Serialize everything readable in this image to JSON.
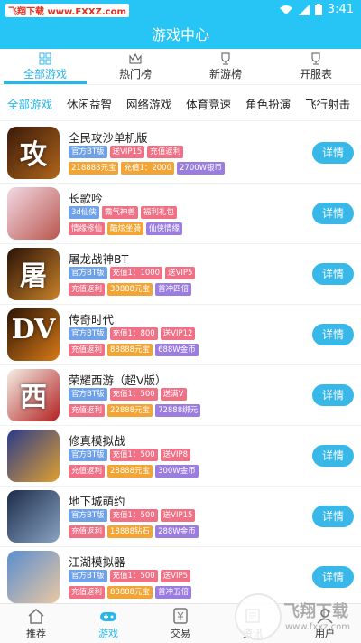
{
  "status": {
    "watermark": "飞翔下载 www.FXXZ.com",
    "time": "3:41"
  },
  "title": "游戏中心",
  "top_tabs": [
    {
      "label": "全部游戏",
      "icon": "grid-icon",
      "active": true
    },
    {
      "label": "热门榜",
      "icon": "crown-icon",
      "active": false
    },
    {
      "label": "新游榜",
      "icon": "trophy-icon",
      "active": false
    },
    {
      "label": "开服表",
      "icon": "trophy-icon",
      "active": false
    }
  ],
  "categories": [
    "全部游戏",
    "休闲益智",
    "网络游戏",
    "体育竞速",
    "角色扮演",
    "飞行射击"
  ],
  "detail_label": "详情",
  "games": [
    {
      "name": "全民攻沙单机版",
      "glyph": "攻沙",
      "icon_colors": [
        "#3a1a0a",
        "#b0651b"
      ],
      "row1": [
        [
          "官方BT版",
          "#6ea1e8"
        ],
        [
          "送VIP15",
          "#f07085"
        ],
        [
          "充值返利",
          "#f07085"
        ]
      ],
      "row2": [
        [
          "218888元宝",
          "#f2a534"
        ],
        [
          "充值1：2000",
          "#f2a534"
        ],
        [
          "2700W银币",
          "#9b7de0"
        ]
      ]
    },
    {
      "name": "长歌吟",
      "glyph": "",
      "icon_colors": [
        "#f3d9e4",
        "#b9574e"
      ],
      "row1": [
        [
          "3d仙侠",
          "#6ea1e8"
        ],
        [
          "霸气神兽",
          "#f07085"
        ],
        [
          "福利礼包",
          "#f07085"
        ]
      ],
      "row2": [
        [
          "情缘修仙",
          "#f07085"
        ],
        [
          "酷炫坐骑",
          "#f2a534"
        ],
        [
          "仙侠情缘",
          "#9b7de0"
        ]
      ]
    },
    {
      "name": "屠龙战神BT",
      "glyph": "屠",
      "icon_colors": [
        "#2a1206",
        "#c9822a"
      ],
      "row1": [
        [
          "官方BT版",
          "#6ea1e8"
        ],
        [
          "充值1：1000",
          "#f07085"
        ],
        [
          "送VIP5",
          "#f07085"
        ]
      ],
      "row2": [
        [
          "充值返利",
          "#f07085"
        ],
        [
          "38888元宝",
          "#f2a534"
        ],
        [
          "首冲四倍",
          "#9b7de0"
        ]
      ]
    },
    {
      "name": "传奇时代",
      "glyph": "DV",
      "icon_colors": [
        "#2d1505",
        "#d77a18"
      ],
      "row1": [
        [
          "官方BT版",
          "#6ea1e8"
        ],
        [
          "充值1：800",
          "#f07085"
        ],
        [
          "送VIP12",
          "#f07085"
        ]
      ],
      "row2": [
        [
          "充值返利",
          "#f07085"
        ],
        [
          "88888元宝",
          "#f2a534"
        ],
        [
          "688W金币",
          "#9b7de0"
        ]
      ]
    },
    {
      "name": "荣耀西游（超V版）",
      "glyph": "西游",
      "icon_colors": [
        "#f4efe6",
        "#b32121"
      ],
      "row1": [
        [
          "官方BT版",
          "#6ea1e8"
        ],
        [
          "充值1：500",
          "#f07085"
        ],
        [
          "送满V",
          "#f07085"
        ]
      ],
      "row2": [
        [
          "充值返利",
          "#f07085"
        ],
        [
          "22888元宝",
          "#f2a534"
        ],
        [
          "72888绑元",
          "#9b7de0"
        ]
      ]
    },
    {
      "name": "修真模拟战",
      "glyph": "",
      "icon_colors": [
        "#2a3a8a",
        "#e0a030"
      ],
      "row1": [
        [
          "官方BT版",
          "#6ea1e8"
        ],
        [
          "充值1：500",
          "#f07085"
        ],
        [
          "送VIP8",
          "#f07085"
        ]
      ],
      "row2": [
        [
          "充值返利",
          "#f07085"
        ],
        [
          "28888元宝",
          "#f2a534"
        ],
        [
          "300W金币",
          "#9b7de0"
        ]
      ]
    },
    {
      "name": "地下城萌约",
      "glyph": "",
      "icon_colors": [
        "#1c2c4a",
        "#8aa3c2"
      ],
      "row1": [
        [
          "官方BT版",
          "#6ea1e8"
        ],
        [
          "充值1：500",
          "#f07085"
        ],
        [
          "送VIP15",
          "#f07085"
        ]
      ],
      "row2": [
        [
          "充值返利",
          "#f07085"
        ],
        [
          "18888钻石",
          "#f2a534"
        ],
        [
          "288W金币",
          "#9b7de0"
        ]
      ]
    },
    {
      "name": "江湖模拟器",
      "glyph": "",
      "icon_colors": [
        "#5a8ecf",
        "#eac7a3"
      ],
      "row1": [
        [
          "官方BT版",
          "#6ea1e8"
        ],
        [
          "充值1：500",
          "#f07085"
        ],
        [
          "送VIP5",
          "#f07085"
        ]
      ],
      "row2": [
        [
          "充值返利",
          "#f07085"
        ],
        [
          "88888元宝",
          "#f2a534"
        ],
        [
          "首冲五倍",
          "#9b7de0"
        ]
      ]
    }
  ],
  "bottom_nav": [
    {
      "label": "推荐",
      "icon": "home-icon",
      "active": false
    },
    {
      "label": "游戏",
      "icon": "gamepad-icon",
      "active": true
    },
    {
      "label": "交易",
      "icon": "yen-icon",
      "active": false
    },
    {
      "label": "资讯",
      "icon": "news-icon",
      "active": false
    },
    {
      "label": "用户",
      "icon": "user-icon",
      "active": false
    }
  ],
  "brand_watermark": {
    "text": "飞翔下载",
    "url": "www.fxxz.com"
  }
}
